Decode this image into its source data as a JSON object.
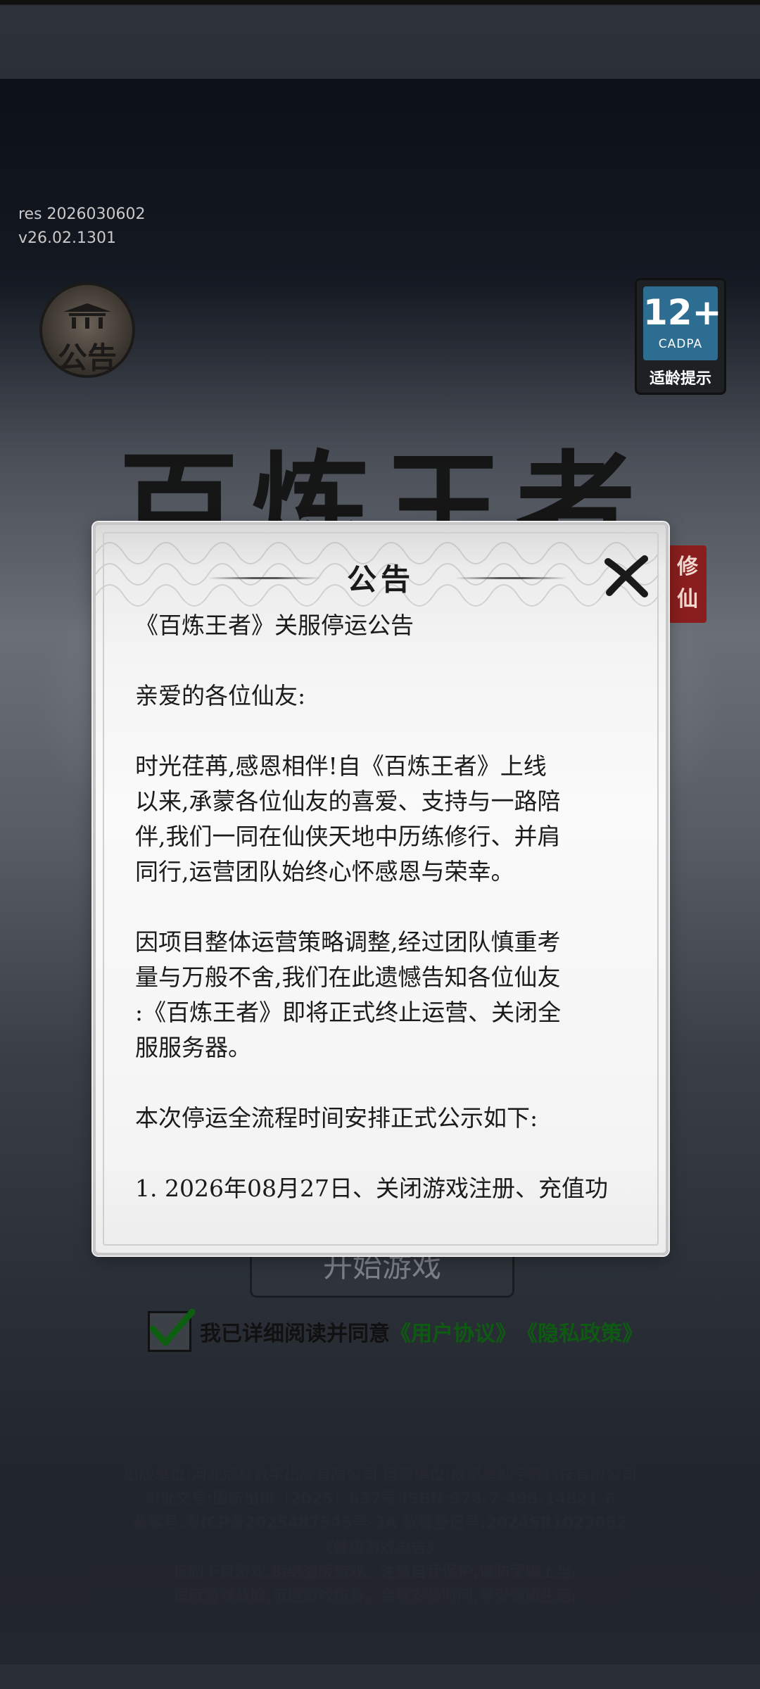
{
  "version": {
    "res": "res 2026030602",
    "app": "v26.02.1301"
  },
  "notice_badge": {
    "label": "公告"
  },
  "age_rating": {
    "age": "12+",
    "org": "CADPA",
    "tip": "适龄提示"
  },
  "logo": {
    "title": "百炼王者",
    "seal": "修仙"
  },
  "start_button": {
    "label": "开始游戏"
  },
  "agreement": {
    "text": "我已详细阅读并同意",
    "user_agreement": "《用户协议》",
    "privacy_policy": "《隐私政策》",
    "checked": true
  },
  "footer": {
    "line1": "出版单位:河北冠林数字出版有限公司    运营单位:成都星灿宇辉科技有限公司",
    "line2": "审批文号:国新出审〔2025〕637号    ISBN:978-7-498-14821-6",
    "line3": "备案号:粤ICP备2025487545号-3A    软著登记号:2024SR1023082",
    "line4": "《健康游戏忠告》",
    "line5": "抵制不良游戏,拒绝盗版游戏。注意自我保护,谨防受骗上当。",
    "line6": "适度游戏益脑,沉迷游戏伤身。合理安排时间,享受健康生活。"
  },
  "modal": {
    "title": "公告",
    "heading": "《百炼王者》关服停运公告",
    "greeting": "亲爱的各位仙友:",
    "p1_lines": [
      "时光荏苒,感恩相伴!自《百炼王者》上线",
      "以来,承蒙各位仙友的喜爱、支持与一路陪",
      "伴,我们一同在仙侠天地中历练修行、并肩",
      "同行,运营团队始终心怀感恩与荣幸。"
    ],
    "p2_lines": [
      "因项目整体运营策略调整,经过团队慎重考",
      "量与万般不舍,我们在此遗憾告知各位仙友",
      ":《百炼王者》即将正式终止运营、关闭全",
      "服服务器。"
    ],
    "p3": "本次停运全流程时间安排正式公示如下:",
    "p4": "1. 2026年08月27日、关闭游戏注册、充值功"
  }
}
